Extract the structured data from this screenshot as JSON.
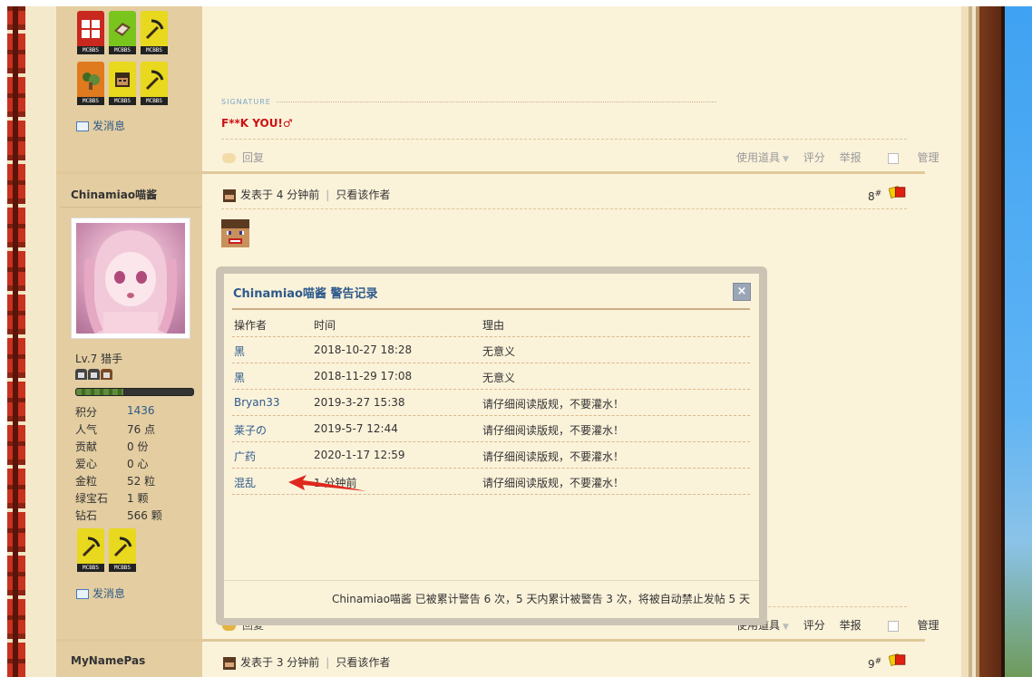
{
  "prev_post": {
    "send_message": "发消息",
    "signature_label": "SIGNATURE",
    "signature_text": "F**K YOU!♂",
    "reply": "回复",
    "actions": [
      "使用道具",
      "评分",
      "举报",
      "管理"
    ]
  },
  "post": {
    "username": "Chinamiao喵酱",
    "posted": "发表于 4 分钟前",
    "only_author": "只看该作者",
    "floor": "8",
    "floor_mark": "#",
    "level": "Lv.7 猎手",
    "xp_fraction": 0.4,
    "stats": [
      {
        "label": "积分",
        "value": "1436"
      },
      {
        "label": "人气",
        "value": "76 点"
      },
      {
        "label": "贡献",
        "value": "0 份"
      },
      {
        "label": "爱心",
        "value": "0 心"
      },
      {
        "label": "金粒",
        "value": "52 粒"
      },
      {
        "label": "绿宝石",
        "value": "1 颗"
      },
      {
        "label": "钻石",
        "value": "566 颗"
      }
    ],
    "send_message": "发消息",
    "reply": "回复",
    "actions": [
      "使用道具",
      "评分",
      "举报",
      "管理"
    ]
  },
  "medal_tag": "MCBBS",
  "dialog": {
    "title": "Chinamiao喵酱 警告记录",
    "close": "×",
    "headers": [
      "操作者",
      "时间",
      "理由"
    ],
    "rows": [
      {
        "operator": "黑",
        "time": "2018-10-27 18:28",
        "reason": "无意义"
      },
      {
        "operator": "黑",
        "time": "2018-11-29 17:08",
        "reason": "无意义"
      },
      {
        "operator": "Bryan33",
        "time": "2019-3-27 15:38",
        "reason": "请仔细阅读版规，不要灌水！"
      },
      {
        "operator": "莱子の",
        "time": "2019-5-7 12:44",
        "reason": "请仔细阅读版规，不要灌水！"
      },
      {
        "operator": "广药",
        "time": "2020-1-17 12:59",
        "reason": "请仔细阅读版规，不要灌水！"
      },
      {
        "operator": "混乱",
        "time": "1 分钟前",
        "reason": "请仔细阅读版规，不要灌水！"
      }
    ],
    "footer": "Chinamiao喵酱 已被累计警告 6 次，5 天内累计被警告 3 次，将被自动禁止发帖 5 天"
  },
  "next_post": {
    "username": "MyNamePas",
    "posted": "发表于 3 分钟前",
    "only_author": "只看该作者",
    "floor": "9",
    "floor_mark": "#"
  },
  "colors": {
    "link": "#2d5a8b",
    "signature": "#cc1111",
    "page_bg": "#fbf2da",
    "sidebar_bg": "#e3cda1"
  }
}
